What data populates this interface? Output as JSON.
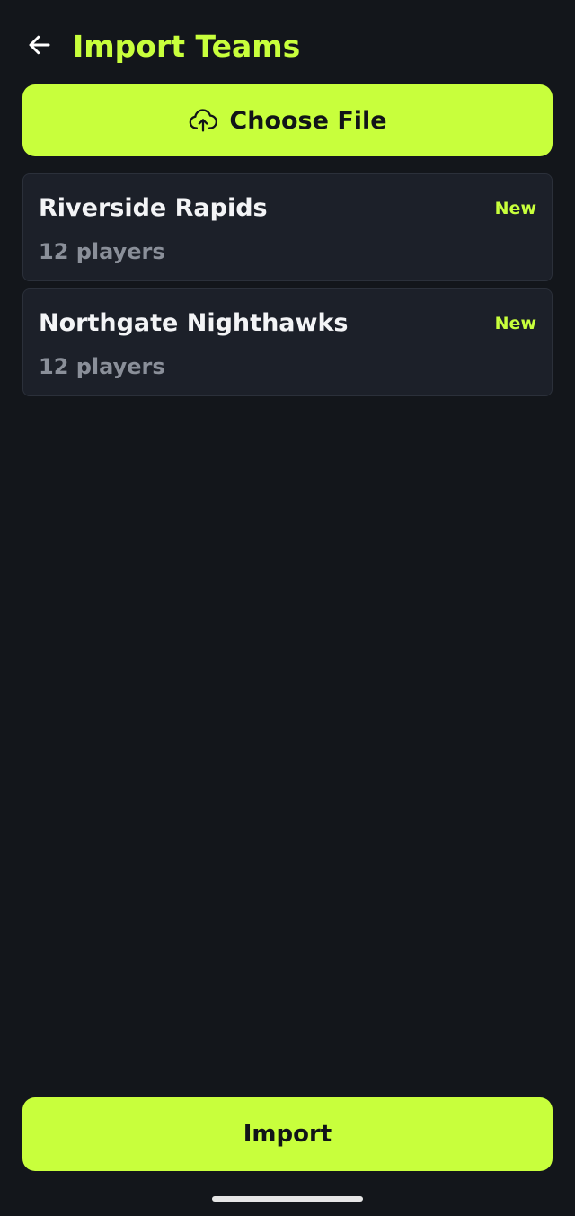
{
  "header": {
    "title": "Import Teams"
  },
  "choose_file": {
    "label": "Choose File",
    "icon": "cloud-upload-icon"
  },
  "teams": [
    {
      "name": "Riverside Rapids",
      "players": "12 players",
      "badge": "New"
    },
    {
      "name": "Northgate Nighthawks",
      "players": "12 players",
      "badge": "New"
    }
  ],
  "import_button": {
    "label": "Import"
  },
  "colors": {
    "background": "#13161b",
    "accent": "#c8ff3c",
    "card": "#1c2029",
    "muted_text": "#8a8f99"
  }
}
